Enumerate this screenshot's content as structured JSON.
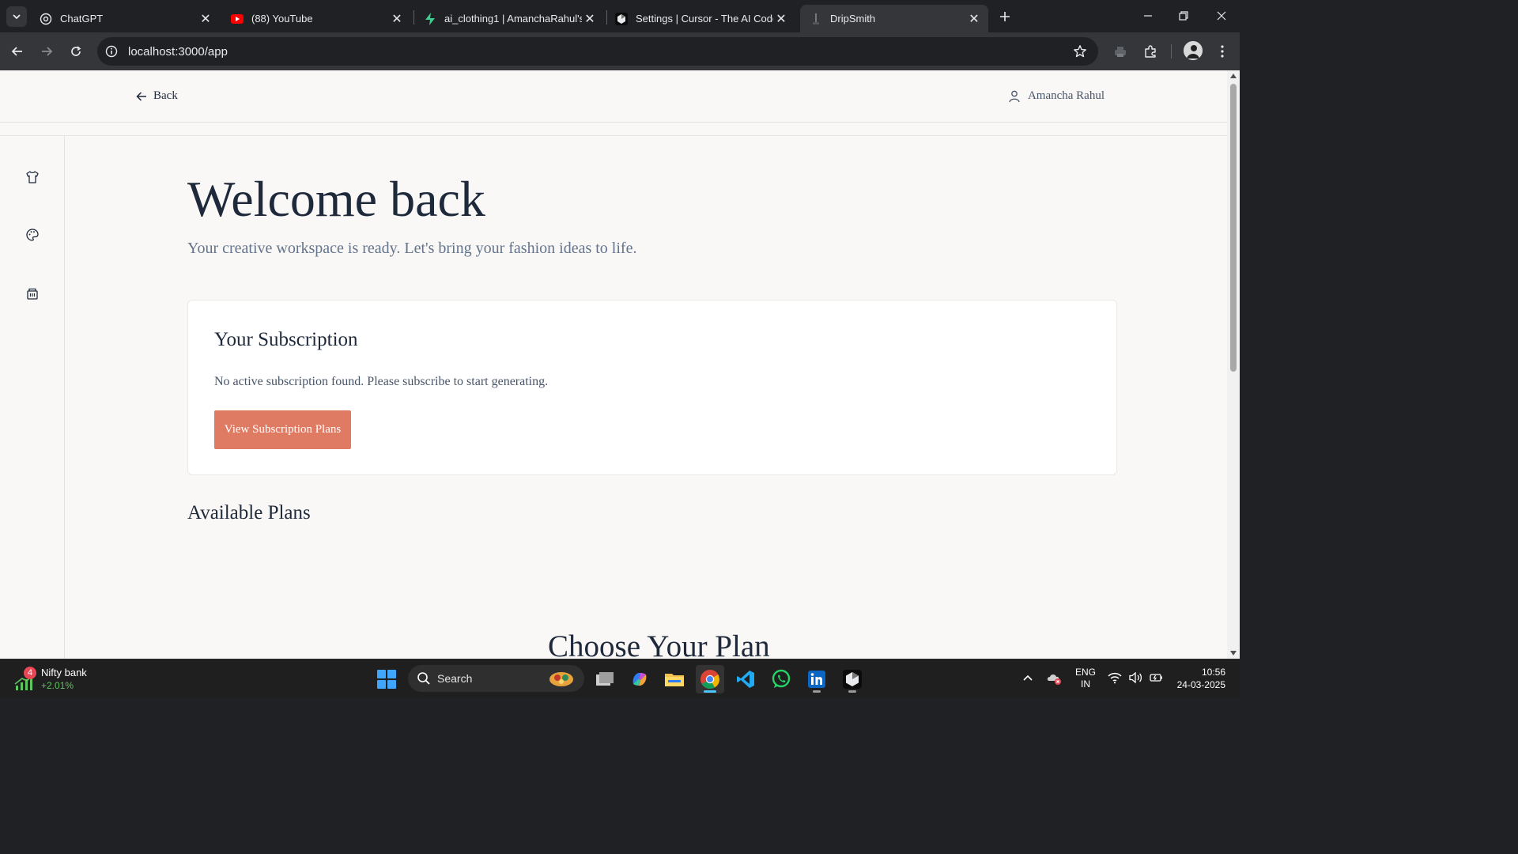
{
  "browser": {
    "tabs": [
      {
        "title": "ChatGPT",
        "icon": "chatgpt-icon"
      },
      {
        "title": "(88) YouTube",
        "icon": "youtube-icon"
      },
      {
        "title": "ai_clothing1 | AmanchaRahul's (",
        "icon": "supabase-icon"
      },
      {
        "title": "Settings | Cursor - The AI Code",
        "icon": "cursor-icon"
      },
      {
        "title": "DripSmith",
        "icon": "page-icon",
        "active": true
      }
    ],
    "url": "localhost:3000/app"
  },
  "app": {
    "header": {
      "back_label": "Back",
      "user_name": "Amancha Rahul"
    },
    "sidebar": [
      {
        "icon": "shirt-icon"
      },
      {
        "icon": "palette-icon"
      },
      {
        "icon": "gallery-icon"
      }
    ],
    "welcome_title": "Welcome back",
    "welcome_subtitle": "Your creative workspace is ready. Let's bring your fashion ideas to life.",
    "subscription": {
      "title": "Your Subscription",
      "message": "No active subscription found. Please subscribe to start generating.",
      "button_label": "View Subscription Plans"
    },
    "available_plans_title": "Available Plans",
    "choose_plan_title": "Choose Your Plan",
    "accent_color": "#e07b63"
  },
  "taskbar": {
    "widget": {
      "badge": "4",
      "title": "Nifty bank",
      "change": "+2.01%"
    },
    "search_label": "Search",
    "apps": [
      "file-explorer-icon",
      "copilot-icon",
      "folder-icon",
      "chrome-icon",
      "vscode-icon",
      "whatsapp-icon",
      "linkedin-icon",
      "cursor-icon"
    ],
    "language": {
      "line1": "ENG",
      "line2": "IN"
    },
    "time": "10:56",
    "date": "24-03-2025"
  }
}
